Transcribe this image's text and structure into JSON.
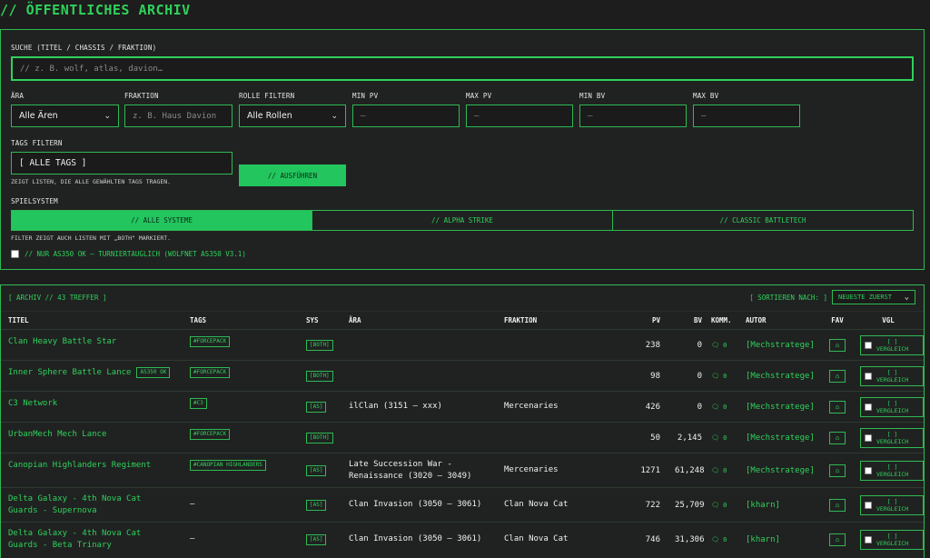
{
  "page_title": "// ÖFFENTLICHES ARCHIV",
  "search": {
    "label": "SUCHE (TITEL / CHASSIS / FRAKTION)",
    "placeholder": "// z. B. wolf, atlas, davion…"
  },
  "filters": {
    "era_label": "ÄRA",
    "era_value": "Alle Ären",
    "faction_label": "FRAKTION",
    "faction_placeholder": "z. B. Haus Davion",
    "role_label": "ROLLE FILTERN",
    "role_value": "Alle Rollen",
    "min_pv_label": "MIN PV",
    "max_pv_label": "MAX PV",
    "min_bv_label": "MIN BV",
    "max_bv_label": "MAX BV",
    "num_placeholder": "—",
    "tags_label": "TAGS FILTERN",
    "tags_value": "[ ALLE TAGS ]",
    "tags_hint": "ZEIGT LISTEN, DIE ALLE GEWÄHLTEN TAGS TRAGEN.",
    "run_button": "// AUSFÜHREN",
    "system_label": "SPIELSYSTEM",
    "systems": [
      "// ALLE SYSTEME",
      "// ALPHA STRIKE",
      "// CLASSIC BATTLETECH"
    ],
    "active_system": "// ALLE SYSTEME",
    "system_hint": "FILTER ZEIGT AUCH LISTEN MIT „BOTH\" MARKIERT.",
    "as350_label": "// NUR AS350 OK — TURNIERTAUGLICH (WOLFNET AS350 V3.1)",
    "as350_checked": false
  },
  "results": {
    "count_label": "[ ARCHIV // 43 TREFFER ]",
    "sort_label": "[ SORTIEREN NACH: ]",
    "sort_value": "NEUESTE ZUERST",
    "columns": {
      "title": "TITEL",
      "tags": "TAGS",
      "sys": "SYS",
      "era": "ÄRA",
      "faction": "FRAKTION",
      "pv": "PV",
      "bv": "BV",
      "comm": "KOMM.",
      "author": "AUTOR",
      "fav": "FAV",
      "vgl": "VGL"
    },
    "compare_label_1": "[ ]",
    "compare_label_2": "VERGLEICH",
    "rows": [
      {
        "title": "Clan Heavy Battle Star",
        "badge": "",
        "tag": "#FORCEPACK",
        "sys": "[BOTH]",
        "era": "",
        "faction": "",
        "pv": "238",
        "bv": "0",
        "comm": "0",
        "author": "[Mechstratege]"
      },
      {
        "title": "Inner Sphere Battle Lance",
        "badge": "AS350 OK",
        "tag": "#FORCEPACK",
        "sys": "[BOTH]",
        "era": "",
        "faction": "",
        "pv": "98",
        "bv": "0",
        "comm": "0",
        "author": "[Mechstratege]"
      },
      {
        "title": "C3 Network",
        "badge": "",
        "tag": "#C3",
        "sys": "[AS]",
        "era": "ilClan (3151 – xxx)",
        "faction": "Mercenaries",
        "pv": "426",
        "bv": "0",
        "comm": "0",
        "author": "[Mechstratege]"
      },
      {
        "title": "UrbanMech Mech Lance",
        "badge": "",
        "tag": "#FORCEPACK",
        "sys": "[BOTH]",
        "era": "",
        "faction": "",
        "pv": "50",
        "bv": "2,145",
        "comm": "0",
        "author": "[Mechstratege]"
      },
      {
        "title": "Canopian Highlanders Regiment",
        "badge": "",
        "tag": "#CANOPIAN HIGHLANDERS",
        "sys": "[AS]",
        "era": "Late Succession War - Renaissance (3020 – 3049)",
        "faction": "Mercenaries",
        "pv": "1271",
        "bv": "61,248",
        "comm": "0",
        "author": "[Mechstratege]"
      },
      {
        "title": "Delta Galaxy - 4th Nova Cat Guards - Supernova",
        "badge": "",
        "tag": "—",
        "sys": "[AS]",
        "era": "Clan Invasion (3050 – 3061)",
        "faction": "Clan Nova Cat",
        "pv": "722",
        "bv": "25,709",
        "comm": "0",
        "author": "[kharn]"
      },
      {
        "title": "Delta Galaxy - 4th Nova Cat Guards - Beta Trinary",
        "badge": "",
        "tag": "—",
        "sys": "[AS]",
        "era": "Clan Invasion (3050 – 3061)",
        "faction": "Clan Nova Cat",
        "pv": "746",
        "bv": "31,306",
        "comm": "0",
        "author": "[kharn]"
      }
    ]
  },
  "colors": {
    "accent": "#2fd15c",
    "button": "#22c55e",
    "background": "#1c1d1c",
    "panel": "#202221"
  }
}
